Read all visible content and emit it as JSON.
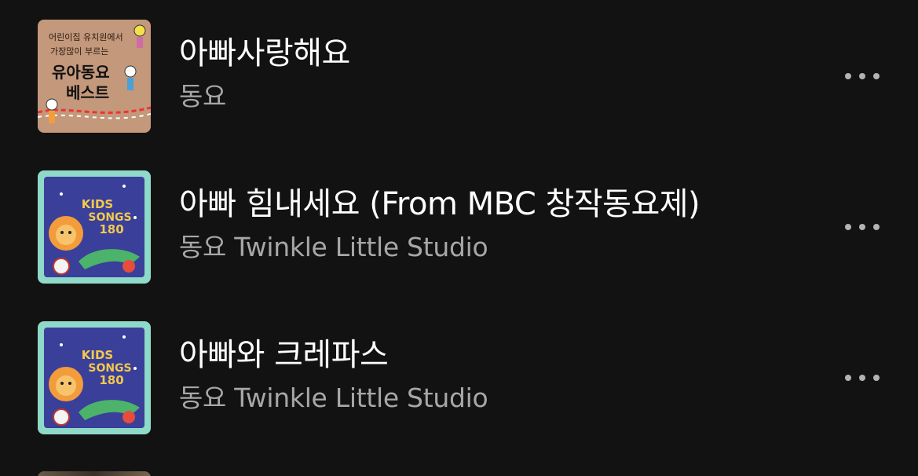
{
  "tracks": [
    {
      "title": "아빠사랑해요",
      "subtitle": "동요",
      "art": {
        "icon": "album-art-kids-best",
        "lines": [
          "어린이집 유치원에서",
          "가장많이 부르는",
          "유아동요",
          "베스트"
        ],
        "bg": "#c79d7f"
      },
      "more_icon": "more-horizontal-icon"
    },
    {
      "title": "아빠 힘내세요 (From MBC 창작동요제)",
      "subtitle": "동요 Twinkle Little Studio",
      "art": {
        "icon": "album-art-kids-songs-180",
        "lines": [
          "KIDS",
          "SONGS",
          "180"
        ],
        "bg": "#3a3f9a",
        "frame": "#8fd9c8"
      },
      "more_icon": "more-horizontal-icon"
    },
    {
      "title": "아빠와 크레파스",
      "subtitle": "동요 Twinkle Little Studio",
      "art": {
        "icon": "album-art-kids-songs-180",
        "lines": [
          "KIDS",
          "SONGS",
          "180"
        ],
        "bg": "#3a3f9a",
        "frame": "#8fd9c8"
      },
      "more_icon": "more-horizontal-icon"
    }
  ],
  "colors": {
    "background": "#121212",
    "title": "#ffffff",
    "subtitle": "#a7a7a7",
    "icon": "#b3b3b3"
  }
}
